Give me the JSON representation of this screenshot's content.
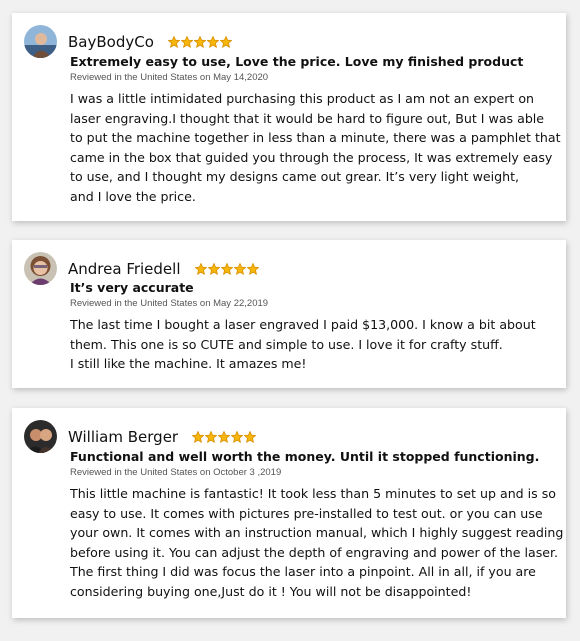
{
  "colors": {
    "star": "#f6b60a",
    "card_bg": "#ffffff",
    "page_bg": "#f1f1f1"
  },
  "reviews": [
    {
      "name": "BayBodyCo",
      "rating": 5,
      "avatar_icon": "user-avatar-icon",
      "title": "Extremely easy to use, Love the price. Love my finished product",
      "meta": "Reviewed in the United States on May 14,2020",
      "body_lines": [
        "I was a little intimidated purchasing this product as I am not an expert on",
        "laser engraving.I thought that it would be hard to figure out, But I was able",
        "to put the machine together in less than a minute, there was a pamphlet that",
        "came in the box that guided you through the process, It was extremely easy",
        "to use, and I thought my designs came out grear. It’s very light weight,",
        "and I love the price."
      ]
    },
    {
      "name": "Andrea Friedell",
      "rating": 5,
      "avatar_icon": "user-avatar-icon",
      "title": "It’s very accurate",
      "meta": "Reviewed in the United States on May 22,2019",
      "body_lines": [
        "The last time I bought a laser engraved I paid $13,000. I know a bit about",
        "them. This one is so CUTE and simple to use. I love it for crafty stuff.",
        "I still like the machine. It amazes me!"
      ]
    },
    {
      "name": "William Berger",
      "rating": 5,
      "avatar_icon": "user-avatar-icon",
      "title": "Functional and well worth the money. Until it stopped functioning.",
      "meta": "Reviewed in the United States on October 3 ,2019",
      "body_lines": [
        "This little machine is fantastic! It took less than 5 minutes to set up and is so",
        "easy to use. It comes with pictures pre-installed to test out. or you can use",
        "your own. It comes with an instruction manual, which I highly suggest reading",
        "before using it. You can adjust the depth of engraving and power of the laser.",
        "The first thing I did was focus the laser into a pinpoint. All in all, if you are",
        "considering buying one,Just do it ! You will not be disappointed!"
      ]
    }
  ]
}
